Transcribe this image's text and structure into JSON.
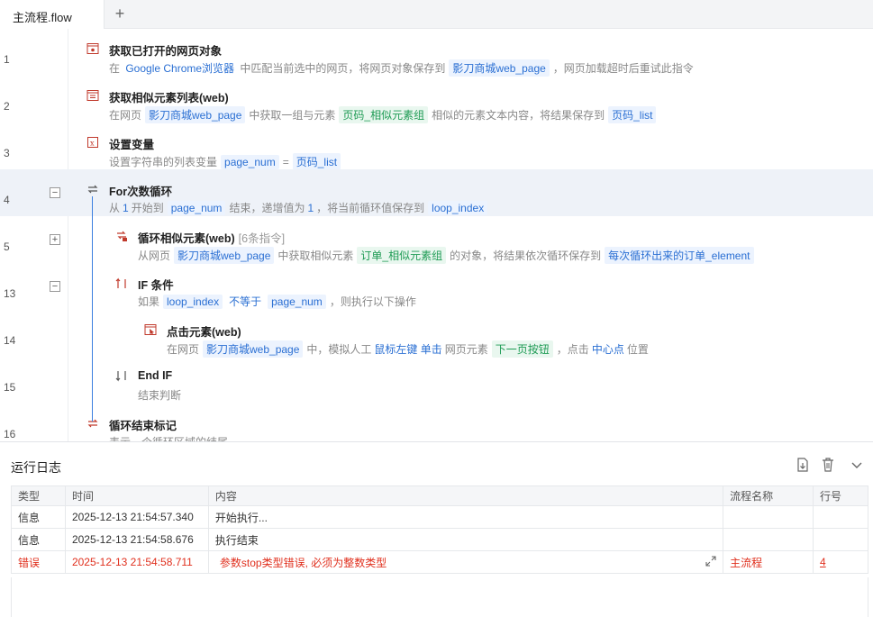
{
  "tabbar": {
    "active_tab": "主流程.flow",
    "add_label": "+"
  },
  "steps": [
    {
      "line": "1",
      "title": "获取已打开的网页对象",
      "desc": [
        {
          "t": "在 "
        },
        {
          "t": "Google Chrome浏览器",
          "k": "hl"
        },
        {
          "t": " 中匹配当前选中的网页，将网页对象保存到"
        },
        {
          "t": "影刀商城web_page",
          "k": "blue"
        },
        {
          "t": "，网页加载超时后重试此指令"
        }
      ]
    },
    {
      "line": "2",
      "title": "获取相似元素列表(web)",
      "desc": [
        {
          "t": "在网页"
        },
        {
          "t": "影刀商城web_page",
          "k": "blue"
        },
        {
          "t": "中获取一组与元素"
        },
        {
          "t": "页码_相似元素组",
          "k": "green"
        },
        {
          "t": "相似的元素文本内容，将结果保存到"
        },
        {
          "t": "页码_list",
          "k": "blue"
        }
      ]
    },
    {
      "line": "3",
      "title": "设置变量",
      "desc": [
        {
          "t": "设置字符串的列表变量"
        },
        {
          "t": "page_num",
          "k": "blue"
        },
        {
          "t": "="
        },
        {
          "t": "页码_list",
          "k": "blue"
        }
      ]
    },
    {
      "line": "4",
      "title": "For次数循环",
      "toggle": "−",
      "desc": [
        {
          "t": "从"
        },
        {
          "t": "1",
          "k": "hl"
        },
        {
          "t": "开始到"
        },
        {
          "t": "page_num",
          "k": "blue"
        },
        {
          "t": "结束，递增值为"
        },
        {
          "t": "1",
          "k": "hl"
        },
        {
          "t": "，将当前循环值保存到"
        },
        {
          "t": "loop_index",
          "k": "blue"
        }
      ]
    },
    {
      "line": "5",
      "title": "循环相似元素(web)",
      "sub": "[6条指令]",
      "toggle": "+",
      "desc": [
        {
          "t": "从网页"
        },
        {
          "t": "影刀商城web_page",
          "k": "blue"
        },
        {
          "t": "中获取相似元素"
        },
        {
          "t": "订单_相似元素组",
          "k": "green"
        },
        {
          "t": "的对象，将结果依次循环保存到"
        },
        {
          "t": "每次循环出来的订单_element",
          "k": "blue"
        }
      ]
    },
    {
      "line": "13",
      "title": "IF 条件",
      "toggle": "−",
      "desc": [
        {
          "t": "如果"
        },
        {
          "t": "loop_index",
          "k": "blue"
        },
        {
          "t": "不等于",
          "k": "hl"
        },
        {
          "t": "page_num",
          "k": "blue"
        },
        {
          "t": "，则执行以下操作"
        }
      ]
    },
    {
      "line": "14",
      "title": "点击元素(web)",
      "desc": [
        {
          "t": "在网页"
        },
        {
          "t": "影刀商城web_page",
          "k": "blue"
        },
        {
          "t": "中，模拟人工"
        },
        {
          "t": "鼠标左键 单击",
          "k": "hl"
        },
        {
          "t": "网页元素"
        },
        {
          "t": "下一页按钮",
          "k": "green"
        },
        {
          "t": "，点击"
        },
        {
          "t": "中心点",
          "k": "hl"
        },
        {
          "t": "位置"
        }
      ]
    },
    {
      "line": "15",
      "title": "End IF",
      "desc": [
        {
          "t": "结束判断"
        }
      ]
    },
    {
      "line": "16",
      "title": "循环结束标记",
      "desc": [
        {
          "t": "表示一个循环区域的结尾"
        }
      ]
    }
  ],
  "log": {
    "title": "运行日志",
    "columns": [
      "类型",
      "时间",
      "内容",
      "流程名称",
      "行号"
    ],
    "rows": [
      {
        "type": "信息",
        "time": "2025-12-13 21:54:57.340",
        "content": "开始执行...",
        "flow": "",
        "line": "",
        "error": false
      },
      {
        "type": "信息",
        "time": "2025-12-13 21:54:58.676",
        "content": "执行结束",
        "flow": "",
        "line": "",
        "error": false
      },
      {
        "type": "错误",
        "time": "2025-12-13 21:54:58.711",
        "content": "参数stop类型错误, 必须为整数类型",
        "flow": "主流程",
        "line": "4",
        "error": true
      }
    ]
  },
  "colors": {
    "accent": "#2a6fd3",
    "tag_green": "#1e9b54",
    "error": "#e0301e",
    "active_row": "#eef2f8"
  }
}
